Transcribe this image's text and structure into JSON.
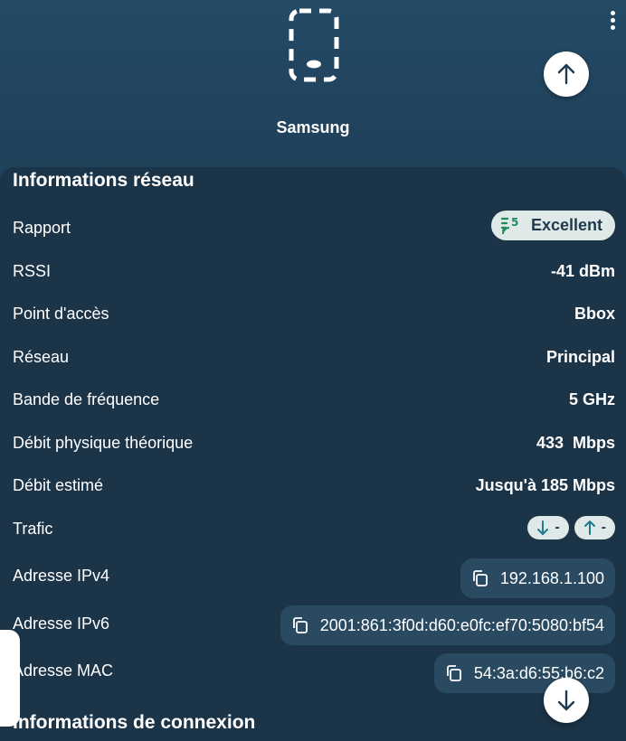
{
  "device": {
    "name": "Samsung",
    "icon": "phone-icon"
  },
  "menu": {
    "icon": "more-vert-icon"
  },
  "nav": {
    "up_icon": "arrow-up-icon",
    "down_icon": "arrow-down-icon"
  },
  "network_info": {
    "title": "Informations réseau",
    "rows": {
      "rapport": {
        "label": "Rapport",
        "value": "Excellent",
        "icon": "wifi-5-icon"
      },
      "rssi": {
        "label": "RSSI",
        "value": "-41 dBm"
      },
      "access_point": {
        "label": "Point d'accès",
        "value": "Bbox"
      },
      "network": {
        "label": "Réseau",
        "value": "Principal"
      },
      "band": {
        "label": "Bande de fréquence",
        "value": "5 GHz"
      },
      "phys_rate": {
        "label": "Débit physique théorique",
        "value": "433  Mbps"
      },
      "est_rate": {
        "label": "Débit estimé",
        "value": "Jusqu'à 185 Mbps"
      },
      "traffic": {
        "label": "Trafic",
        "down": "-",
        "up": "-"
      },
      "ipv4": {
        "label": "Adresse IPv4",
        "value": "192.168.1.100"
      },
      "ipv6": {
        "label": "Adresse IPv6",
        "value": "2001:861:3f0d:d60:e0fc:ef70:5080:bf54"
      },
      "mac": {
        "label": "Adresse MAC",
        "value": "54:3a:d6:55:b6:c2"
      }
    }
  },
  "connection_info": {
    "title": "Informations de connexion"
  },
  "colors": {
    "header": "#244a66",
    "panel": "#1c3448",
    "chip": "#dfe9e7",
    "accent_green": "#1f8a5a"
  }
}
